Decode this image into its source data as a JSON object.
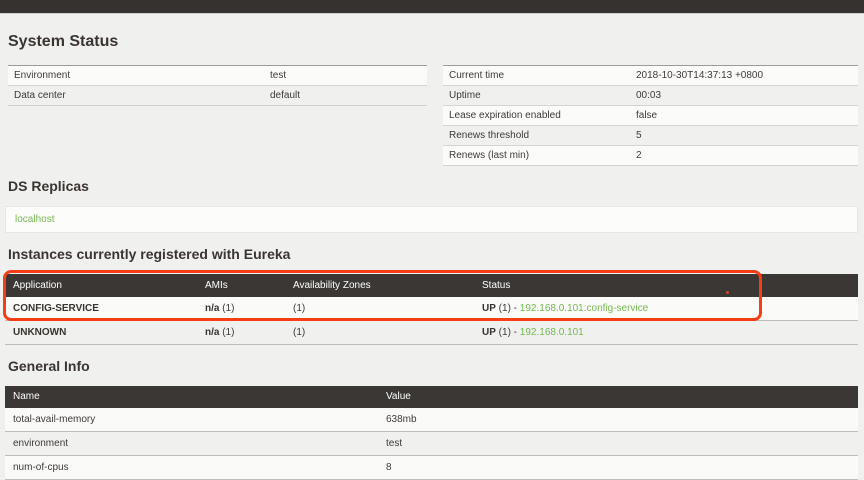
{
  "system_status": {
    "heading": "System Status",
    "left_rows": [
      {
        "label": "Environment",
        "value": "test"
      },
      {
        "label": "Data center",
        "value": "default"
      }
    ],
    "right_rows": [
      {
        "label": "Current time",
        "value": "2018-10-30T14:37:13 +0800"
      },
      {
        "label": "Uptime",
        "value": "00:03"
      },
      {
        "label": "Lease expiration enabled",
        "value": "false"
      },
      {
        "label": "Renews threshold",
        "value": "5"
      },
      {
        "label": "Renews (last min)",
        "value": "2"
      }
    ]
  },
  "ds_replicas": {
    "heading": "DS Replicas",
    "links": [
      {
        "label": "localhost"
      }
    ]
  },
  "instances": {
    "heading": "Instances currently registered with Eureka",
    "columns": {
      "application": "Application",
      "amis": "AMIs",
      "zones": "Availability Zones",
      "status": "Status"
    },
    "rows": [
      {
        "application": "CONFIG-SERVICE",
        "amis_bold": "n/a",
        "amis_rest": " (1)",
        "zones": "(1)",
        "status_bold": "UP",
        "status_sep": " (1) - ",
        "status_link": "192.168.0.101:config-service"
      },
      {
        "application": "UNKNOWN",
        "amis_bold": "n/a",
        "amis_rest": " (1)",
        "zones": "(1)",
        "status_bold": "UP",
        "status_sep": " (1) - ",
        "status_link": "192.168.0.101"
      }
    ]
  },
  "general_info": {
    "heading": "General Info",
    "columns": {
      "name": "Name",
      "value": "Value"
    },
    "rows": [
      {
        "name": "total-avail-memory",
        "value": "638mb"
      },
      {
        "name": "environment",
        "value": "test"
      },
      {
        "name": "num-of-cpus",
        "value": "8"
      }
    ]
  },
  "colors": {
    "accent_green": "#74b851",
    "header_dark": "#3b3734",
    "annotation_red": "#f63e16",
    "page_bg": "#f0f0ef"
  }
}
